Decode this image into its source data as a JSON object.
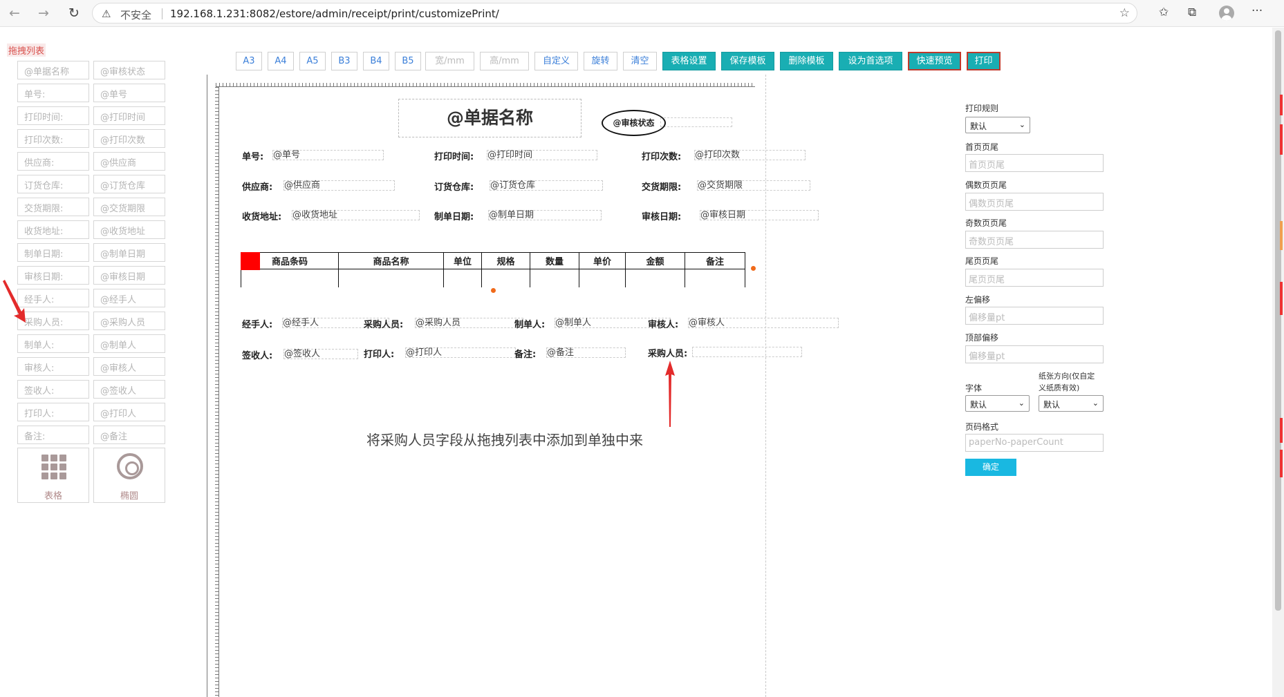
{
  "browser": {
    "security_label": "不安全",
    "url": "192.168.1.231:8082/estore/admin/receipt/print/customizePrint/"
  },
  "drag_list": {
    "title": "拖拽列表",
    "fields": [
      [
        "@单据名称",
        "@审核状态"
      ],
      [
        "单号:",
        "@单号"
      ],
      [
        "打印时间:",
        "@打印时间"
      ],
      [
        "打印次数:",
        "@打印次数"
      ],
      [
        "供应商:",
        "@供应商"
      ],
      [
        "订货仓库:",
        "@订货仓库"
      ],
      [
        "交货期限:",
        "@交货期限"
      ],
      [
        "收货地址:",
        "@收货地址"
      ],
      [
        "制单日期:",
        "@制单日期"
      ],
      [
        "审核日期:",
        "@审核日期"
      ],
      [
        "经手人:",
        "@经手人"
      ],
      [
        "采购人员:",
        "@采购人员"
      ],
      [
        "制单人:",
        "@制单人"
      ],
      [
        "审核人:",
        "@审核人"
      ],
      [
        "签收人:",
        "@签收人"
      ],
      [
        "打印人:",
        "@打印人"
      ],
      [
        "备注:",
        "@备注"
      ]
    ],
    "tools": {
      "table": "表格",
      "ellipse": "椭圆"
    }
  },
  "toolbar": {
    "paper_sizes": [
      "A3",
      "A4",
      "A5",
      "B3",
      "B4",
      "B5"
    ],
    "width_placeholder": "宽/mm",
    "height_placeholder": "高/mm",
    "custom": "自定义",
    "rotate": "旋转",
    "clear": "清空",
    "table_settings": "表格设置",
    "save_template": "保存模板",
    "delete_template": "删除模板",
    "set_preferred": "设为首选项",
    "quick_preview": "快速预览",
    "print": "打印"
  },
  "canvas": {
    "doc_title": "@单据名称",
    "status": "@审核状态",
    "rows": [
      [
        {
          "label": "单号:",
          "value": "@单号"
        },
        {
          "label": "打印时间:",
          "value": "@打印时间"
        },
        {
          "label": "打印次数:",
          "value": "@打印次数"
        }
      ],
      [
        {
          "label": "供应商:",
          "value": "@供应商"
        },
        {
          "label": "订货仓库:",
          "value": "@订货仓库"
        },
        {
          "label": "交货期限:",
          "value": "@交货期限"
        }
      ],
      [
        {
          "label": "收货地址:",
          "value": "@收货地址"
        },
        {
          "label": "制单日期:",
          "value": "@制单日期"
        },
        {
          "label": "审核日期:",
          "value": "@审核日期"
        }
      ]
    ],
    "table_headers": [
      "商品条码",
      "商品名称",
      "单位",
      "规格",
      "数量",
      "单价",
      "金额",
      "备注"
    ],
    "footer_row1": [
      {
        "label": "经手人:",
        "value": "@经手人"
      },
      {
        "label": "采购人员:",
        "value": "@采购人员"
      },
      {
        "label": "制单人:",
        "value": "@制单人"
      },
      {
        "label": "审核人:",
        "value": "@审核人"
      }
    ],
    "footer_row2": [
      {
        "label": "签收人:",
        "value": "@签收人"
      },
      {
        "label": "打印人:",
        "value": "@打印人"
      },
      {
        "label": "备注:",
        "value": "@备注"
      },
      {
        "label": "采购人员:",
        "value": ""
      }
    ],
    "annotation": "将采购人员字段从拖拽列表中添加到单独中来"
  },
  "settings": {
    "print_rule_label": "打印规则",
    "print_rule_value": "默认",
    "first_header_label": "首页页尾",
    "first_header_placeholder": "首页页尾",
    "even_label": "偶数页页尾",
    "even_placeholder": "偶数页页尾",
    "odd_label": "奇数页页尾",
    "odd_placeholder": "奇数页页尾",
    "last_label": "尾页页尾",
    "last_placeholder": "尾页页尾",
    "left_offset_label": "左偏移",
    "left_offset_placeholder": "偏移量pt",
    "top_offset_label": "顶部偏移",
    "top_offset_placeholder": "偏移量pt",
    "font_label": "字体",
    "font_value": "默认",
    "orientation_label_1": "纸张方向(仅自定",
    "orientation_label_2": "义纸质有效)",
    "orientation_value": "默认",
    "page_format_label": "页码格式",
    "page_format_placeholder": "paperNo-paperCount",
    "confirm": "确定"
  },
  "colors": {
    "accent": "#19aeb3",
    "confirm": "#19b8e1",
    "link": "#3b7fd9",
    "handle": "#ff0000",
    "dot": "#f06a1a"
  }
}
